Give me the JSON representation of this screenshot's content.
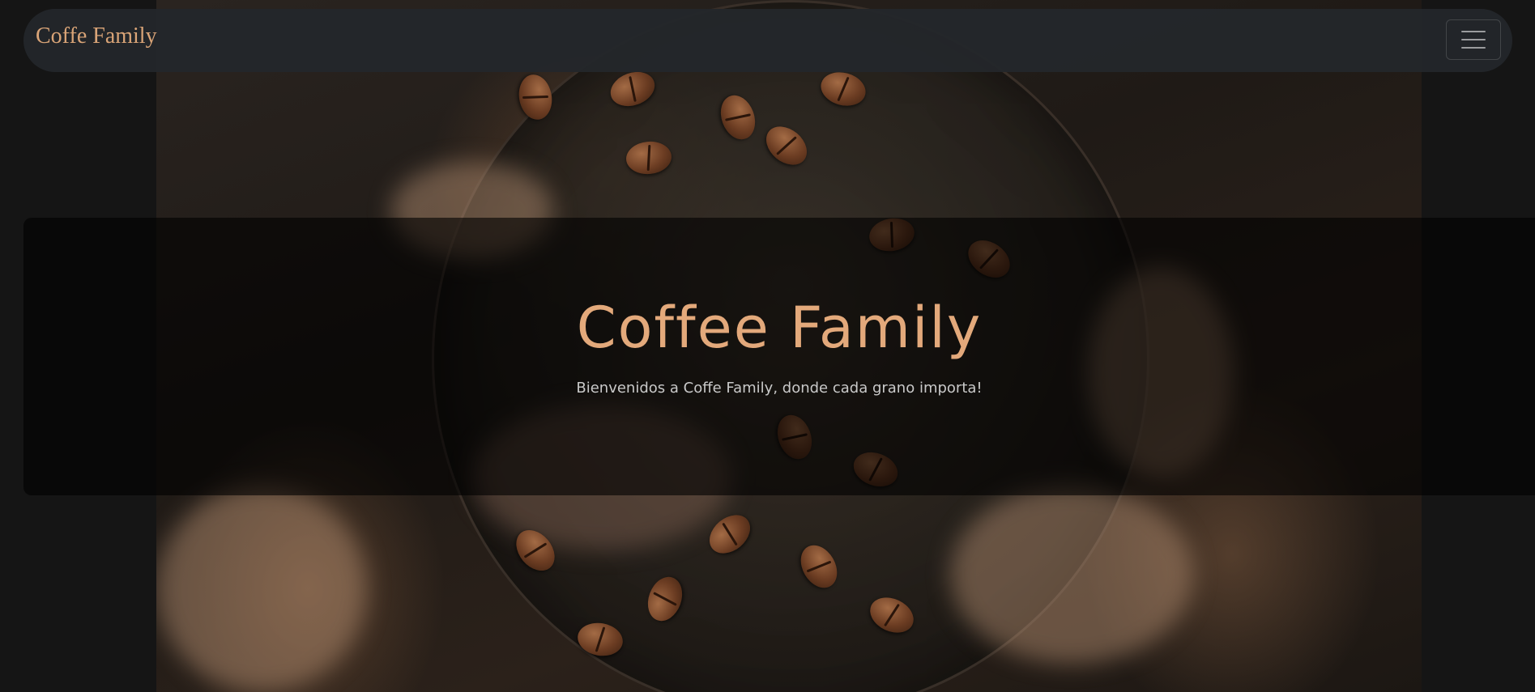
{
  "navbar": {
    "brand": "Coffe Family",
    "toggler_icon": "hamburger-icon"
  },
  "hero": {
    "title": "Coffee Family",
    "subtitle": "Bienvenidos a Coffe Family, donde cada grano importa!"
  },
  "colors": {
    "page_background": "#151515",
    "navbar_background": "#23262b",
    "accent": "#e3a97b",
    "subtitle_text": "#c9c9c9"
  }
}
